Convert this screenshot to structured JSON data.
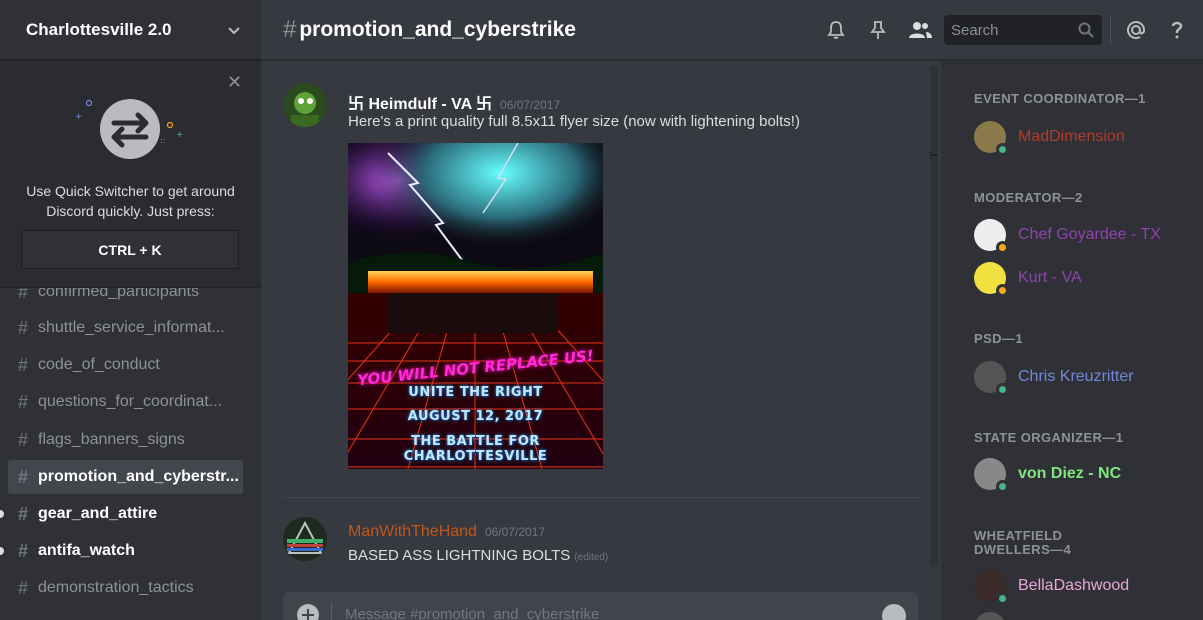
{
  "server": {
    "name": "Charlottesville 2.0"
  },
  "quick_switcher": {
    "line1": "Use Quick Switcher to get around",
    "line2": "Discord quickly. Just press:",
    "shortcut": "CTRL + K"
  },
  "channels": [
    {
      "name": "confirmed_participants",
      "state": "partial"
    },
    {
      "name": "shuttle_service_informat...",
      "state": "normal"
    },
    {
      "name": "code_of_conduct",
      "state": "normal"
    },
    {
      "name": "questions_for_coordinat...",
      "state": "normal"
    },
    {
      "name": "flags_banners_signs",
      "state": "normal"
    },
    {
      "name": "promotion_and_cyberstr...",
      "state": "active"
    },
    {
      "name": "gear_and_attire",
      "state": "unread"
    },
    {
      "name": "antifa_watch",
      "state": "unread"
    },
    {
      "name": "demonstration_tactics",
      "state": "normal"
    }
  ],
  "channel_header": {
    "hash": "#",
    "title": "promotion_and_cyberstrike",
    "search_placeholder": "Search"
  },
  "header_icons": [
    "bell-icon",
    "pin-icon",
    "members-icon",
    "search-icon",
    "mention-icon",
    "help-icon"
  ],
  "messages": [
    {
      "author": "卐 Heimdulf - VA 卐",
      "author_color": "#ffffff",
      "time": "06/07/2017",
      "text": "Here's a print quality full 8.5x11 flyer size (now with lightening bolts!)",
      "attachment": {
        "line1": "YOU WILL NOT REPLACE US!",
        "line2": "UNITE THE RIGHT",
        "line3": "AUGUST 12, 2017",
        "line4": "THE BATTLE FOR CHARLOTTESVILLE"
      }
    },
    {
      "author": "ManWithTheHand",
      "author_color": "#c1571b",
      "time": "06/07/2017",
      "text": "BASED ASS LIGHTNING BOLTS",
      "edited": "(edited)"
    }
  ],
  "input": {
    "placeholder": "Message #promotion_and_cyberstrike"
  },
  "roles": [
    {
      "title": "EVENT COORDINATOR—1",
      "members": [
        {
          "name": "MadDimension",
          "color": "#b33a2c",
          "status": "online"
        }
      ]
    },
    {
      "title": "MODERATOR—2",
      "members": [
        {
          "name": "Chef Goyardee - TX",
          "color": "#8e44ad",
          "status": "idle"
        },
        {
          "name": "Kurt - VA",
          "color": "#8e44ad",
          "status": "idle"
        }
      ]
    },
    {
      "title": "PSD—1",
      "members": [
        {
          "name": "Chris Kreuzritter",
          "color": "#7289da",
          "status": "online"
        }
      ]
    },
    {
      "title": "STATE ORGANIZER—1",
      "members": [
        {
          "name": "von Diez - NC",
          "color": "#7fe67f",
          "status": "online"
        }
      ]
    },
    {
      "title": "WHEATFIELD DWELLERS—4",
      "members": [
        {
          "name": "BellaDashwood",
          "color": "#e8a7d8",
          "status": "online"
        }
      ]
    }
  ],
  "colors": {
    "online": "#43b581",
    "idle": "#faa61a",
    "accent": "#7289da"
  }
}
